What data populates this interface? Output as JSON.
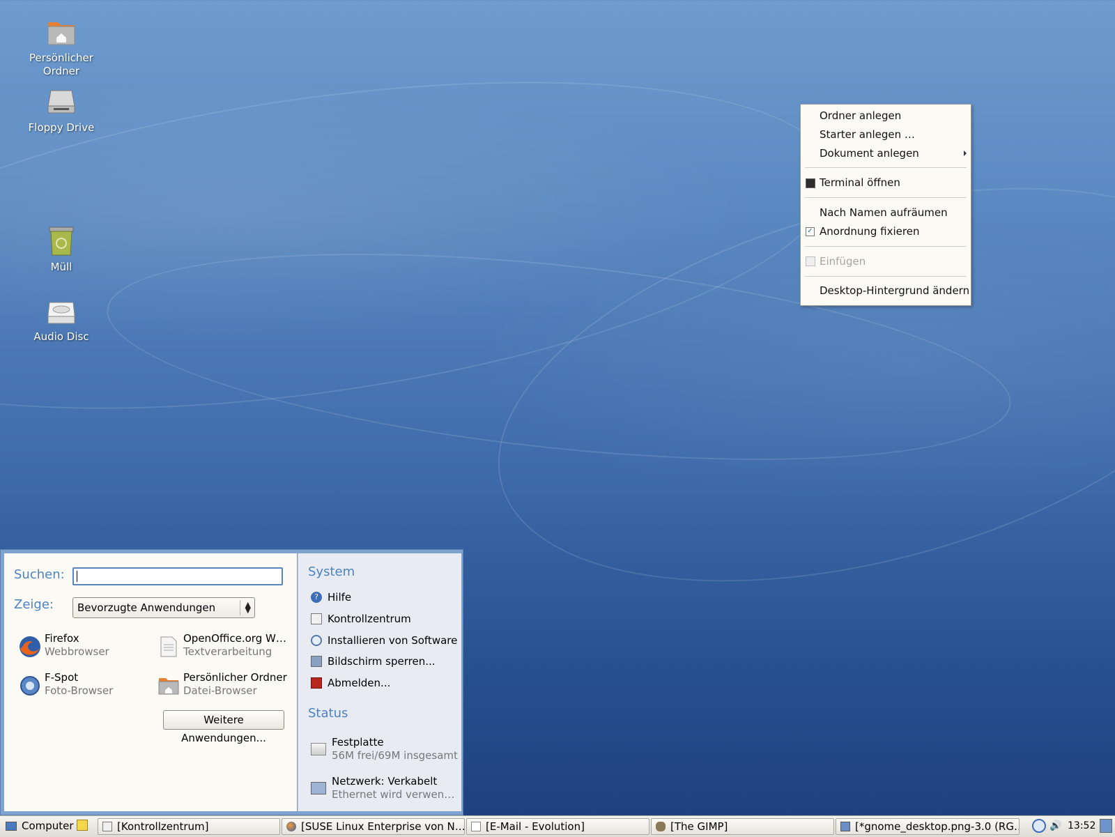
{
  "desktop": {
    "icons": [
      {
        "label_line1": "Persönlicher",
        "label_line2": "Ordner",
        "icon": "home-folder-icon"
      },
      {
        "label": "Floppy Drive",
        "icon": "floppy-drive-icon"
      },
      {
        "label": "Müll",
        "icon": "trash-icon"
      },
      {
        "label": "Audio Disc",
        "icon": "audio-disc-icon"
      }
    ]
  },
  "context_menu": {
    "items": [
      {
        "label": "Ordner anlegen"
      },
      {
        "label": "Starter anlegen …"
      },
      {
        "label": "Dokument anlegen",
        "submenu": true
      },
      {
        "label": "Terminal öffnen",
        "icon": "terminal-icon"
      },
      {
        "label": "Nach Namen aufräumen"
      },
      {
        "label": "Anordnung fixieren",
        "checked": true
      },
      {
        "label": "Einfügen",
        "disabled": true,
        "icon": "paste-icon"
      },
      {
        "label": "Desktop-Hintergrund ändern"
      }
    ]
  },
  "main_menu": {
    "search_label": "Suchen:",
    "search_value": "",
    "show_label": "Zeige:",
    "show_selected": "Bevorzugte Anwendungen",
    "apps": [
      {
        "name": "Firefox",
        "desc": "Webbrowser",
        "icon": "firefox-icon"
      },
      {
        "name": "OpenOffice.org W…",
        "desc": "Textverarbeitung",
        "icon": "document-icon"
      },
      {
        "name": "F-Spot",
        "desc": "Foto-Browser",
        "icon": "fspot-icon"
      },
      {
        "name": "Persönlicher Ordner",
        "desc": "Datei-Browser",
        "icon": "home-folder-icon"
      }
    ],
    "more_button": "Weitere Anwendungen...",
    "system_title": "System",
    "system_items": [
      {
        "label": "Hilfe",
        "icon": "help-icon"
      },
      {
        "label": "Kontrollzentrum",
        "icon": "control-center-icon"
      },
      {
        "label": "Installieren von Software",
        "icon": "install-software-icon"
      },
      {
        "label": "Bildschirm sperren...",
        "icon": "lock-screen-icon"
      },
      {
        "label": "Abmelden...",
        "icon": "logout-icon"
      }
    ],
    "status_title": "Status",
    "status_items": [
      {
        "title": "Festplatte",
        "detail": "56M frei/69M insgesamt",
        "icon": "harddisk-icon"
      },
      {
        "title": "Netzwerk: Verkabelt",
        "detail": "Ethernet wird verwen…",
        "icon": "network-icon"
      }
    ]
  },
  "taskbar": {
    "computer_label": "Computer",
    "windows": [
      {
        "label": "[Kontrollzentrum]",
        "icon": "control-center-icon"
      },
      {
        "label": "[SUSE Linux Enterprise von N…",
        "icon": "firefox-icon"
      },
      {
        "label": "[E-Mail - Evolution]",
        "icon": "mail-icon"
      },
      {
        "label": "[The GIMP]",
        "icon": "gimp-icon"
      },
      {
        "label": "[*gnome_desktop.png-3.0 (RG…",
        "icon": "image-icon"
      }
    ],
    "clock": "13:52"
  }
}
